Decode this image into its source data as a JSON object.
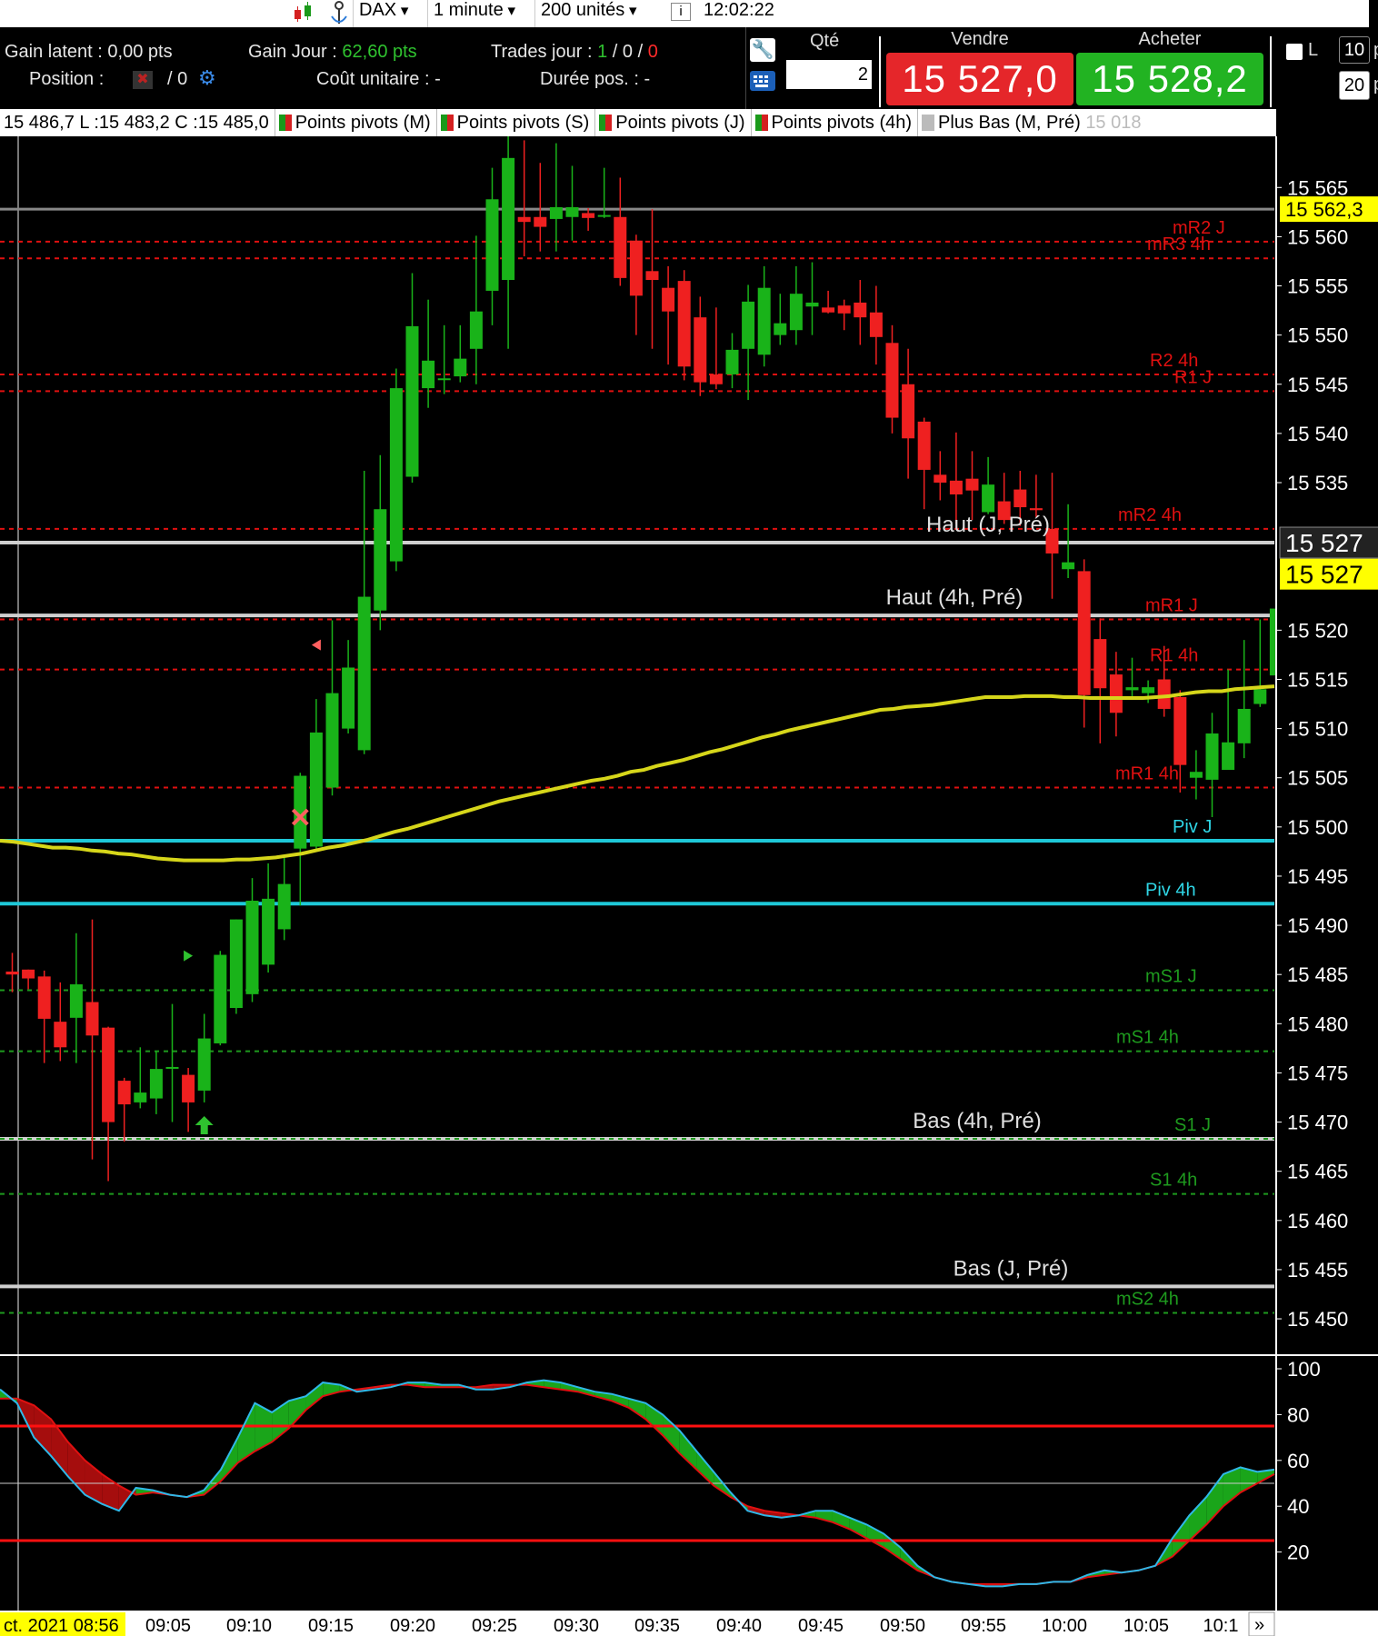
{
  "toolbar": {
    "instrument": "DAX",
    "timeframe": "1 minute",
    "units": "200 unités",
    "clock": "12:02:22",
    "icons": [
      "candles-icon",
      "anchor-icon",
      "info-icon"
    ]
  },
  "info": {
    "gain_latent_label": "Gain latent : ",
    "gain_latent_value": "0,00 pts",
    "gain_jour_label": "Gain Jour : ",
    "gain_jour_value": "62,60 pts",
    "trades_label": "Trades jour : ",
    "trades_win": "1",
    "trades_sep1": " / ",
    "trades_flat": "0",
    "trades_sep2": " / ",
    "trades_loss": "0",
    "position_label": "Position : ",
    "position_value": "/ 0",
    "cout_label": "Coût unitaire : -",
    "duree_label": "Durée pos. : -"
  },
  "order": {
    "qty_label": "Qté",
    "qty_value": "2",
    "sell_label": "Vendre",
    "sell_price": "15 527,0",
    "buy_label": "Acheter",
    "buy_price": "15 528,2",
    "checkbox_label": "L",
    "side_box_1": "10",
    "side_box_1_suffix": "p",
    "side_box_2": "20",
    "side_box_2_suffix": "p",
    "sell_color": "#e5262a",
    "buy_color": "#22b322"
  },
  "legend": {
    "ohlc": "15 486,7 L :15 483,2 C :15 485,0",
    "items": [
      "Points pivots (M)",
      "Points pivots (S)",
      "Points pivots (J)",
      "Points pivots (4h)",
      "Plus Bas (M, Pré)"
    ],
    "faded_value": "15 018"
  },
  "chart_data": {
    "type": "candlestick",
    "instrument": "DAX",
    "timeframe": "1 minute",
    "candles": [
      [
        15485.3,
        15487.2,
        15483.2,
        15485.0
      ],
      [
        15485.5,
        15485.5,
        15483.5,
        15484.6
      ],
      [
        15484.8,
        15485.4,
        15476.0,
        15480.5
      ],
      [
        15480.2,
        15484.2,
        15476.2,
        15477.6
      ],
      [
        15480.6,
        15489.2,
        15476.0,
        15484.0
      ],
      [
        15482.2,
        15490.6,
        15466.2,
        15478.8
      ],
      [
        15479.6,
        15479.7,
        15464.0,
        15470.0
      ],
      [
        15474.2,
        15474.5,
        15468.0,
        15471.8
      ],
      [
        15472.0,
        15477.6,
        15471.4,
        15473.0
      ],
      [
        15472.4,
        15477.2,
        15470.8,
        15475.4
      ],
      [
        15475.5,
        15482.0,
        15470.0,
        15475.6
      ],
      [
        15474.8,
        15475.5,
        15469.0,
        15472.0
      ],
      [
        15473.2,
        15481.0,
        15472.0,
        15478.5
      ],
      [
        15478.0,
        15487.4,
        15477.8,
        15487.0
      ],
      [
        15481.6,
        15490.6,
        15481.0,
        15490.6
      ],
      [
        15483.0,
        15494.8,
        15482.2,
        15492.5
      ],
      [
        15486.0,
        15496.3,
        15485.2,
        15492.7
      ],
      [
        15489.6,
        15496.9,
        15488.5,
        15494.2
      ],
      [
        15497.8,
        15505.5,
        15492.0,
        15505.2
      ],
      [
        15498.0,
        15513.0,
        15497.8,
        15509.6
      ],
      [
        15504.0,
        15521.0,
        15503.2,
        15513.6
      ],
      [
        15510.0,
        15519.0,
        15509.5,
        15516.2
      ],
      [
        15507.8,
        15536.2,
        15507.4,
        15523.4
      ],
      [
        15522.0,
        15537.8,
        15520.0,
        15532.3
      ],
      [
        15527.0,
        15546.6,
        15526.0,
        15544.6
      ],
      [
        15535.6,
        15556.3,
        15535.0,
        15550.9
      ],
      [
        15544.6,
        15553.6,
        15542.6,
        15547.4
      ],
      [
        15545.5,
        15551.0,
        15544.0,
        15545.6
      ],
      [
        15545.8,
        15551.0,
        15545.2,
        15547.6
      ],
      [
        15548.6,
        15560.1,
        15545.0,
        15552.4
      ],
      [
        15554.5,
        15567.0,
        15551.0,
        15563.8
      ],
      [
        15555.6,
        15570.2,
        15548.6,
        15568.0
      ],
      [
        15562.0,
        15569.8,
        15558.0,
        15561.5
      ],
      [
        15562.0,
        15567.5,
        15558.5,
        15561.0
      ],
      [
        15561.8,
        15569.5,
        15558.5,
        15563.0
      ],
      [
        15562.0,
        15567.2,
        15559.6,
        15563.0
      ],
      [
        15562.4,
        15562.9,
        15560.6,
        15561.9
      ],
      [
        15562.2,
        15567.0,
        15561.9,
        15562.2
      ],
      [
        15562.0,
        15566.0,
        15555.0,
        15555.8
      ],
      [
        15559.6,
        15560.2,
        15550.0,
        15554.0
      ],
      [
        15556.5,
        15562.8,
        15548.6,
        15555.6
      ],
      [
        15554.8,
        15557.0,
        15547.0,
        15552.4
      ],
      [
        15555.5,
        15556.6,
        15545.4,
        15546.8
      ],
      [
        15551.8,
        15553.9,
        15543.8,
        15545.2
      ],
      [
        15546.0,
        15552.8,
        15544.5,
        15545.0
      ],
      [
        15546.0,
        15550.2,
        15544.6,
        15548.5
      ],
      [
        15548.6,
        15555.1,
        15543.4,
        15553.4
      ],
      [
        15548.0,
        15557.0,
        15546.8,
        15554.8
      ],
      [
        15550.0,
        15554.2,
        15549.0,
        15551.2
      ],
      [
        15550.5,
        15557.0,
        15549.0,
        15554.2
      ],
      [
        15552.9,
        15557.4,
        15550.0,
        15553.3
      ],
      [
        15552.8,
        15554.5,
        15552.2,
        15552.3
      ],
      [
        15553.0,
        15553.6,
        15550.5,
        15552.2
      ],
      [
        15553.3,
        15555.6,
        15549.0,
        15551.8
      ],
      [
        15552.3,
        15555.0,
        15547.0,
        15549.8
      ],
      [
        15549.2,
        15551.0,
        15540.0,
        15541.6
      ],
      [
        15545.0,
        15548.6,
        15535.4,
        15539.5
      ],
      [
        15541.2,
        15541.6,
        15532.3,
        15536.3
      ],
      [
        15535.8,
        15538.2,
        15533.2,
        15535.0
      ],
      [
        15535.2,
        15540.1,
        15530.8,
        15533.8
      ],
      [
        15535.4,
        15538.2,
        15531.2,
        15534.2
      ],
      [
        15532.0,
        15537.6,
        15531.8,
        15534.8
      ],
      [
        15533.1,
        15536.0,
        15530.8,
        15531.2
      ],
      [
        15534.3,
        15536.2,
        15530.6,
        15532.5
      ],
      [
        15532.4,
        15535.8,
        15531.5,
        15532.2
      ],
      [
        15530.3,
        15536.0,
        15523.2,
        15527.8
      ],
      [
        15526.2,
        15532.8,
        15525.3,
        15526.9
      ],
      [
        15526.0,
        15527.2,
        15510.1,
        15513.4
      ],
      [
        15519.1,
        15521.2,
        15508.5,
        15514.1
      ],
      [
        15515.5,
        15517.8,
        15509.2,
        15511.6
      ],
      [
        15513.9,
        15517.2,
        15513.0,
        15514.2
      ],
      [
        15513.6,
        15514.9,
        15512.6,
        15514.2
      ],
      [
        15515.0,
        15518.4,
        15511.2,
        15512.0
      ],
      [
        15513.2,
        15513.9,
        15503.5,
        15506.3
      ],
      [
        15505.0,
        15507.8,
        15502.8,
        15505.6
      ],
      [
        15504.8,
        15511.6,
        15501.0,
        15509.5
      ],
      [
        15505.8,
        15516.0,
        15506.4,
        15508.6
      ],
      [
        15508.5,
        15519.0,
        15507.0,
        15512.0
      ],
      [
        15512.5,
        15521.1,
        15512.2,
        15514.0
      ],
      [
        15515.4,
        15523.9,
        15512.5,
        15522.2
      ],
      [
        15518.2,
        15530.7,
        15516.4,
        15520.2
      ],
      [
        15520.1,
        15527.9,
        15521.0,
        15524.8
      ],
      [
        15523.0,
        15530.2,
        15521.8,
        15520.5
      ],
      [
        15524.0,
        15525.0,
        15518.0,
        15519.6
      ],
      [
        15521.0,
        15522.0,
        15519.4,
        15521.4
      ],
      [
        15520.4,
        15525.5,
        15518.0,
        15521.0
      ],
      [
        15521.2,
        15523.8,
        15519.5,
        15521.6
      ]
    ],
    "sma": [
      15498.6,
      15498.5,
      15498.3,
      15498.1,
      15497.9,
      15497.9,
      15497.8,
      15497.6,
      15497.5,
      15497.3,
      15497.2,
      15497.0,
      15496.8,
      15496.7,
      15496.6,
      15496.6,
      15496.6,
      15496.6,
      15496.7,
      15496.7,
      15496.8,
      15496.9,
      15497.1,
      15497.3,
      15497.6,
      15497.9,
      15498.1,
      15498.4,
      15498.7,
      15499.1,
      15499.5,
      15499.8,
      15500.2,
      15500.6,
      15501.0,
      15501.4,
      15501.8,
      15502.2,
      15502.6,
      15502.9,
      15503.2,
      15503.5,
      15503.8,
      15504.1,
      15504.4,
      15504.7,
      15504.9,
      15505.2,
      15505.6,
      15505.8,
      15506.2,
      15506.5,
      15506.8,
      15507.2,
      15507.6,
      15507.9,
      15508.3,
      15508.7,
      15509.1,
      15509.4,
      15509.8,
      15510.1,
      15510.4,
      15510.7,
      15511.0,
      15511.3,
      15511.6,
      15511.9,
      15512.0,
      15512.2,
      15512.3,
      15512.4,
      15512.6,
      15512.8,
      15513.0,
      15513.2,
      15513.2,
      15513.2,
      15513.3,
      15513.3,
      15513.3,
      15513.2,
      15513.2,
      15513.1,
      15513.1,
      15513.1,
      15513.1,
      15513.1,
      15513.2,
      15513.3,
      15513.5,
      15513.7,
      15513.8,
      15513.8,
      15514.0,
      15514.1,
      15514.2,
      15514.3
    ],
    "price_levels": [
      {
        "value": 15562.8,
        "label": "",
        "style": "solid",
        "color": "#888888"
      },
      {
        "value": 15559.5,
        "label": "mR2 J",
        "style": "dashed",
        "color": "#e01010"
      },
      {
        "value": 15557.8,
        "label": "mR3 4h",
        "style": "dashed",
        "color": "#e01010"
      },
      {
        "value": 15546.0,
        "label": "R2 4h",
        "style": "dashed",
        "color": "#e01010"
      },
      {
        "value": 15544.3,
        "label": "R1 J",
        "style": "dashed",
        "color": "#e01010"
      },
      {
        "value": 15530.3,
        "label": "mR2 4h",
        "style": "dashed",
        "color": "#e01010"
      },
      {
        "value": 15528.9,
        "label": "Haut (J, Pré)",
        "style": "solid",
        "color": "#cfcfcf"
      },
      {
        "value": 15521.5,
        "label": "Haut (4h, Pré)",
        "style": "solid",
        "color": "#cfcfcf"
      },
      {
        "value": 15521.1,
        "label": "mR1 J",
        "style": "dashed",
        "color": "#e01010"
      },
      {
        "value": 15516.0,
        "label": "R1 4h",
        "style": "dashed",
        "color": "#e01010"
      },
      {
        "value": 15504.0,
        "label": "mR1 4h",
        "style": "dashed",
        "color": "#e01010"
      },
      {
        "value": 15498.6,
        "label": "Piv J",
        "style": "solid",
        "color": "#1ec8d8"
      },
      {
        "value": 15492.2,
        "label": "Piv 4h",
        "style": "solid",
        "color": "#1ec8d8"
      },
      {
        "value": 15483.4,
        "label": "mS1 J",
        "style": "dashed",
        "color": "#1e9a1e"
      },
      {
        "value": 15477.2,
        "label": "mS1 4h",
        "style": "dashed",
        "color": "#1e9a1e"
      },
      {
        "value": 15468.3,
        "label": "Bas (4h, Pré)",
        "style": "solid",
        "color": "#cfcfcf"
      },
      {
        "value": 15468.3,
        "label": "S1 J",
        "style": "dashed",
        "color": "#1e9a1e"
      },
      {
        "value": 15462.7,
        "label": "S1 4h",
        "style": "dashed",
        "color": "#1e9a1e"
      },
      {
        "value": 15453.3,
        "label": "Bas (J, Pré)",
        "style": "solid",
        "color": "#cfcfcf"
      },
      {
        "value": 15450.6,
        "label": "mS2 4h",
        "style": "dashed",
        "color": "#1e9a1e"
      }
    ],
    "price_axis": {
      "ticks": [
        "15 565",
        "15 560",
        "15 555",
        "15 550",
        "15 545",
        "15 540",
        "15 535",
        "15 520",
        "15 515",
        "15 510",
        "15 505",
        "15 500",
        "15 495",
        "15 490",
        "15 485",
        "15 480",
        "15 475",
        "15 470",
        "15 465",
        "15 460",
        "15 455",
        "15 450"
      ],
      "min": 15446.4,
      "max": 15570.2
    },
    "price_tags": [
      {
        "text": "15 562,3",
        "value": 15562.8,
        "bg": "#ffff00",
        "fg": "#000000"
      },
      {
        "text": "15 527",
        "value": 15528.9,
        "bg": "#222222",
        "fg": "#ffffff"
      },
      {
        "text": "15 527",
        "value": 15525.7,
        "bg": "#ffff00",
        "fg": "#000000"
      }
    ],
    "markers": [
      {
        "type": "arrow-up",
        "index": 12,
        "value": 15469.5,
        "color": "#2fc22f"
      },
      {
        "type": "triangle-right",
        "index": 11,
        "value": 15486.9,
        "color": "#2fc22f"
      },
      {
        "type": "cross",
        "index": 18,
        "value": 15501.0,
        "color": "#ff6060"
      },
      {
        "type": "triangle-left",
        "index": 19,
        "value": 15518.5,
        "color": "#ff6060"
      }
    ],
    "oscillator": {
      "ticks": [
        "100",
        "80",
        "60",
        "40",
        "20"
      ],
      "levels": [
        {
          "value": 75,
          "color": "#ff1010"
        },
        {
          "value": 50,
          "color": "#cccccc"
        },
        {
          "value": 25,
          "color": "#ff1010"
        }
      ],
      "fast": [
        91,
        85,
        70,
        62,
        53,
        45,
        41,
        38,
        48,
        47,
        45,
        44,
        47,
        56,
        70,
        85,
        81,
        86,
        88,
        94,
        93,
        90,
        91,
        92,
        94,
        94,
        93,
        93,
        91,
        91,
        92,
        94,
        95,
        94,
        92,
        90,
        89,
        87,
        85,
        80,
        73,
        64,
        55,
        46,
        38,
        36,
        35,
        36,
        38,
        38,
        35,
        32,
        28,
        22,
        14,
        9,
        7,
        6,
        5,
        5,
        6,
        6,
        7,
        7,
        10,
        12,
        11,
        12,
        14,
        26,
        36,
        44,
        54,
        57,
        55,
        56
      ],
      "slow": [
        87,
        87,
        84,
        78,
        68,
        60,
        54,
        49,
        45,
        46,
        45,
        44,
        45,
        51,
        59,
        64,
        68,
        74,
        82,
        88,
        90,
        91,
        92,
        93,
        93,
        92,
        92,
        92,
        92,
        93,
        93,
        93,
        92,
        91,
        90,
        88,
        86,
        83,
        78,
        71,
        63,
        56,
        49,
        44,
        40,
        38,
        37,
        36,
        35,
        33,
        30,
        26,
        22,
        17,
        12,
        9,
        7,
        6,
        6,
        6,
        6,
        6,
        7,
        7,
        9,
        10,
        11,
        12,
        14,
        18,
        25,
        32,
        40,
        46,
        50,
        54
      ]
    },
    "x_ticks": [
      "ct. 2021 08:56",
      "09:05",
      "09:10",
      "09:15",
      "09:20",
      "09:25",
      "09:30",
      "09:35",
      "09:40",
      "09:45",
      "09:50",
      "09:55",
      "10:00",
      "10:05",
      "10:1"
    ]
  }
}
